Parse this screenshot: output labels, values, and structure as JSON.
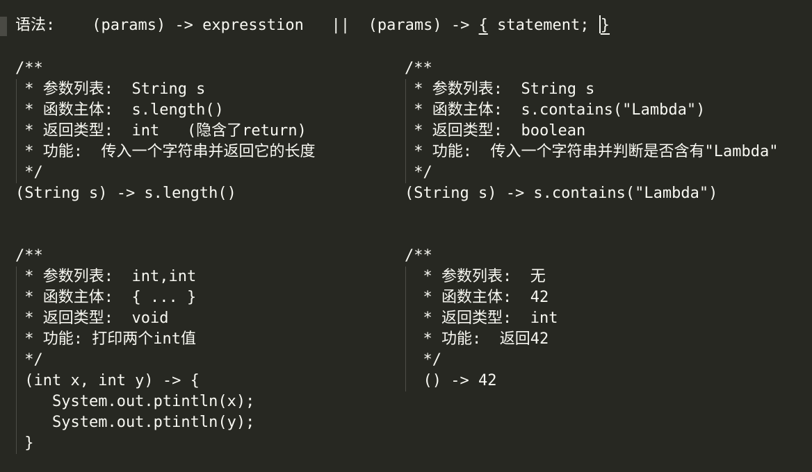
{
  "header": {
    "label": "语法:",
    "form1": "(params) -> expresstion",
    "separator": "||",
    "form2_prefix": "(params) -> ",
    "form2_open": "{",
    "form2_middle": " statement; ",
    "form2_close": "}"
  },
  "block1": {
    "lines": [
      "/**",
      " * 参数列表:  String s",
      " * 函数主体:  s.length()",
      " * 返回类型:  int   (隐含了return)",
      " * 功能:  传入一个字符串并返回它的长度",
      " */",
      "(String s) -> s.length()"
    ]
  },
  "block2": {
    "lines": [
      "/**",
      " * 参数列表:  String s",
      " * 函数主体:  s.contains(\"Lambda\")",
      " * 返回类型:  boolean",
      " * 功能:  传入一个字符串并判断是否含有\"Lambda\"",
      " */",
      "(String s) -> s.contains(\"Lambda\")"
    ]
  },
  "block3": {
    "lines": [
      "/**",
      " * 参数列表:  int,int",
      " * 函数主体:  { ... }",
      " * 返回类型:  void",
      " * 功能: 打印两个int值",
      " */",
      " (int x, int y) -> {",
      "    System.out.ptintln(x);",
      "    System.out.ptintln(y);",
      " }"
    ]
  },
  "block4": {
    "lines": [
      "/**",
      "  * 参数列表:  无",
      "  * 函数主体:  42",
      "  * 返回类型:  int",
      "  * 功能:  返回42",
      "  */",
      "  () -> 42"
    ]
  }
}
